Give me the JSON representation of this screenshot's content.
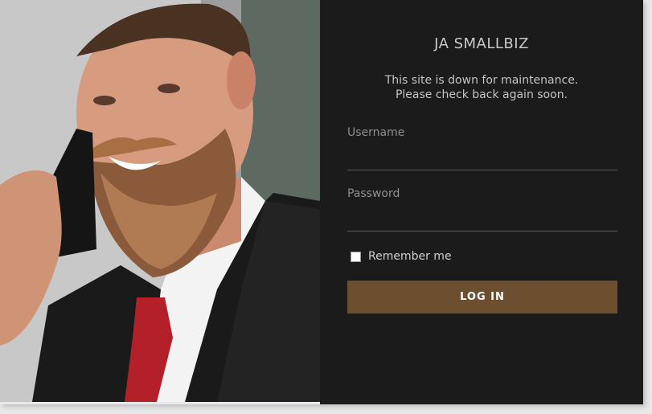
{
  "site": {
    "title": "JA SMALLBIZ",
    "maintenance_line1": "This site is down for maintenance.",
    "maintenance_line2": "Please check back again soon."
  },
  "form": {
    "username_label": "Username",
    "username_value": "",
    "password_label": "Password",
    "password_value": "",
    "remember_label": "Remember me",
    "remember_checked": false,
    "login_label": "LOG IN"
  },
  "colors": {
    "panel_bg": "#1b1b1b",
    "button_bg": "#6b4f2e",
    "page_bg": "#e9e9e9"
  },
  "icons": {
    "checkbox": "checkbox-icon"
  }
}
